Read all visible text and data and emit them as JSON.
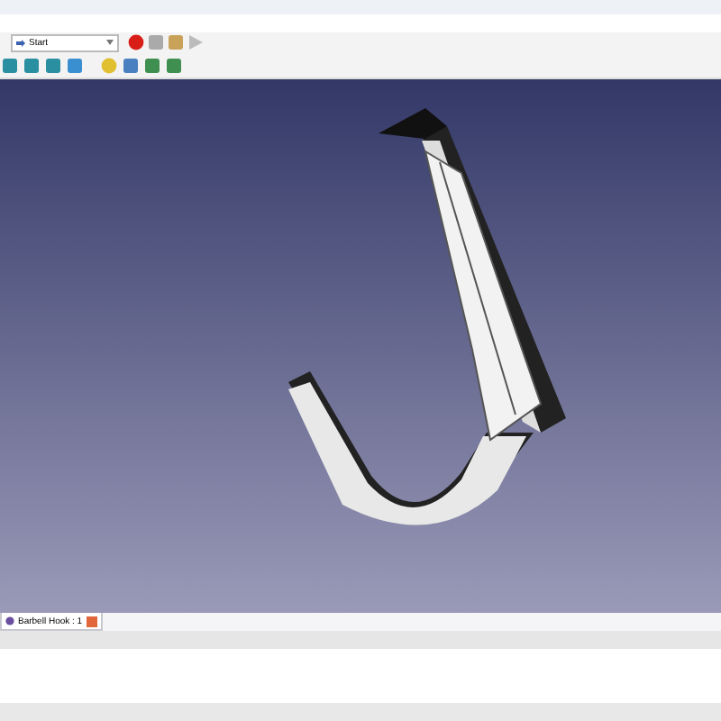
{
  "toolbar": {
    "workbench": "Start"
  },
  "document_tabs": [
    {
      "label": "Barbell Hook : 1",
      "selected": true
    }
  ]
}
